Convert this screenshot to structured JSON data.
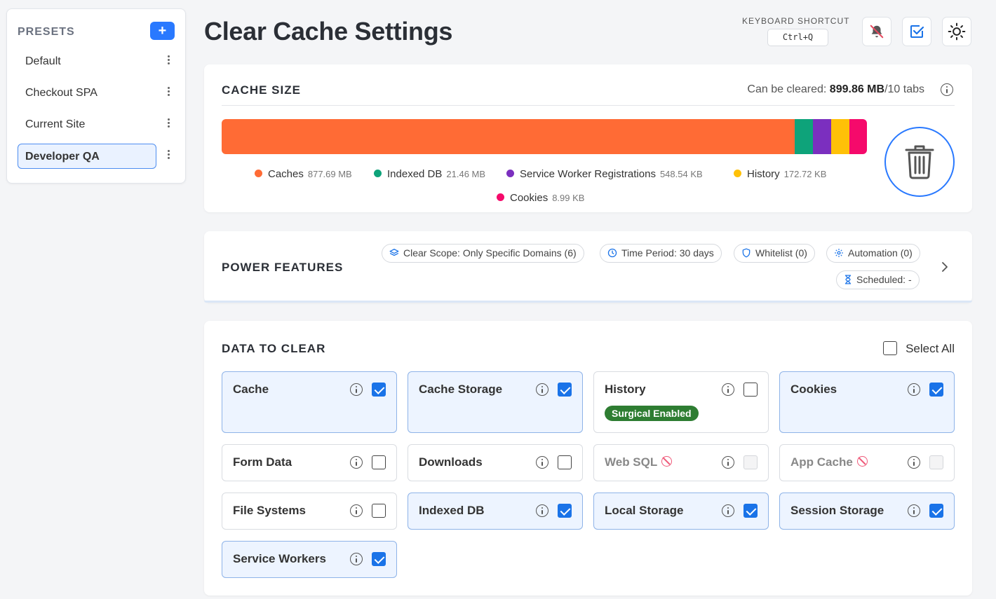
{
  "sidebar": {
    "title": "PRESETS",
    "add_label": "+",
    "items": [
      {
        "label": "Default"
      },
      {
        "label": "Checkout SPA"
      },
      {
        "label": "Current Site"
      },
      {
        "label": "Developer QA"
      }
    ]
  },
  "header": {
    "title": "Clear Cache Settings",
    "shortcut_label": "KEYBOARD SHORTCUT",
    "shortcut_key": "Ctrl+Q"
  },
  "cache_size": {
    "title": "CACHE SIZE",
    "summary_prefix": "Can be cleared: ",
    "summary_amount": "899.86 MB",
    "summary_suffix": "/10 tabs",
    "segments": [
      {
        "name": "Caches",
        "value": "877.69 MB",
        "color": "#ff6b35",
        "fraction": 0.8883
      },
      {
        "name": "Indexed DB",
        "value": "21.46 MB",
        "color": "#0ea37a",
        "fraction": 0.0283
      },
      {
        "name": "Service Worker Registrations",
        "value": "548.54 KB",
        "color": "#7b2fbf",
        "fraction": 0.0283
      },
      {
        "name": "History",
        "value": "172.72 KB",
        "color": "#ffc107",
        "fraction": 0.0283
      },
      {
        "name": "Cookies",
        "value": "8.99 KB",
        "color": "#f50a6b",
        "fraction": 0.0268
      }
    ]
  },
  "power_features": {
    "title": "POWER FEATURES",
    "pills": [
      {
        "label": "Clear Scope: Only Specific Domains (6)"
      },
      {
        "label": "Time Period: 30 days"
      },
      {
        "label": "Whitelist (0)"
      },
      {
        "label": "Automation (0)"
      },
      {
        "label": "Scheduled: -"
      }
    ]
  },
  "data_to_clear": {
    "title": "DATA TO CLEAR",
    "select_all": "Select All",
    "items": [
      {
        "label": "Cache",
        "checked": true,
        "disabled": false
      },
      {
        "label": "Cache Storage",
        "checked": true,
        "disabled": false
      },
      {
        "label": "History",
        "checked": false,
        "disabled": false,
        "badge": "Surgical Enabled"
      },
      {
        "label": "Cookies",
        "checked": true,
        "disabled": false
      },
      {
        "label": "Form Data",
        "checked": false,
        "disabled": false
      },
      {
        "label": "Downloads",
        "checked": false,
        "disabled": false
      },
      {
        "label": "Web SQL",
        "checked": false,
        "disabled": true
      },
      {
        "label": "App Cache",
        "checked": false,
        "disabled": true
      },
      {
        "label": "File Systems",
        "checked": false,
        "disabled": false
      },
      {
        "label": "Indexed DB",
        "checked": true,
        "disabled": false
      },
      {
        "label": "Local Storage",
        "checked": true,
        "disabled": false
      },
      {
        "label": "Session Storage",
        "checked": true,
        "disabled": false
      },
      {
        "label": "Service Workers",
        "checked": true,
        "disabled": false
      }
    ]
  }
}
